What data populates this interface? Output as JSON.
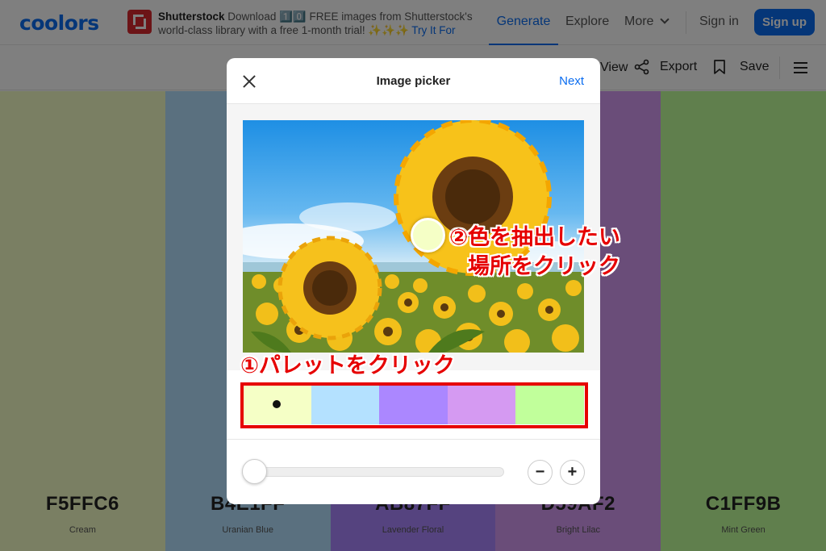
{
  "nav": {
    "logo": "coolors",
    "ad": {
      "brand": "Shutterstock",
      "text": "Download 1️⃣0️⃣ FREE images from Shutterstock's world-class library with a free 1-month trial! ✨✨✨",
      "cta": "Try It For"
    },
    "links": {
      "generate": "Generate",
      "explore": "Explore",
      "more": "More",
      "signin": "Sign in",
      "signup": "Sign up"
    }
  },
  "toolbar": {
    "view": "View",
    "export": "Export",
    "save": "Save"
  },
  "palette": [
    {
      "hex": "F5FFC6",
      "name": "Cream",
      "color": "#f5ffc6"
    },
    {
      "hex": "B4E1FF",
      "name": "Uranian Blue",
      "color": "#b4e1ff"
    },
    {
      "hex": "AB87FF",
      "name": "Lavender Floral",
      "color": "#ab87ff"
    },
    {
      "hex": "D59AF2",
      "name": "Bright Lilac",
      "color": "#d59af2"
    },
    {
      "hex": "C1FF9B",
      "name": "Mint Green",
      "color": "#c1ff9b"
    }
  ],
  "modal": {
    "title": "Image picker",
    "next": "Next",
    "zoom_out": "−",
    "zoom_in": "+",
    "selected_swatch_index": 0
  },
  "annotations": {
    "step1": "①パレットをクリック",
    "step2_line1": "②色を抽出したい",
    "step2_line2": "場所をクリック",
    "highlight_color": "#e60000"
  }
}
